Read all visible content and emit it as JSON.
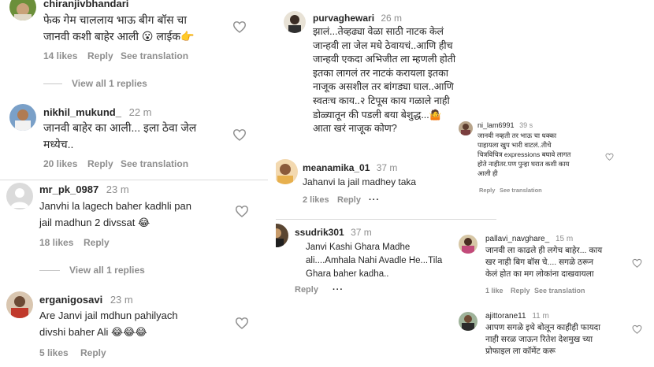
{
  "left_panel": {
    "comments": [
      {
        "username": "chiranjivbhandari",
        "time": "",
        "text": "फेक गेम चाललाय भाऊ बीग बॉस चा\nजानवी कशी बाहेर आली 😮 लाईक👉",
        "likes": "14 likes",
        "reply": "Reply",
        "translate": "See translation"
      },
      {
        "username": "nikhil_mukund_",
        "time": "22 m",
        "text": "जानवी बाहेर का आली... इला ठेवा जेल\nमध्येच..",
        "likes": "20 likes",
        "reply": "Reply",
        "translate": "See translation"
      },
      {
        "username": "mr_pk_0987",
        "time": "23 m",
        "text": "Janvhi la lagech baher kadhli pan\njail madhun 2 divssat 😂",
        "likes": "18 likes",
        "reply": "Reply",
        "translate": ""
      },
      {
        "username": "erganigosavi",
        "time": "23 m",
        "text": "Are Janvi jail mdhun pahilyach\ndivshi baher Ali 😂😂😂",
        "likes": "5 likes",
        "reply": "Reply",
        "translate": ""
      }
    ],
    "view_replies_1": "View all 1 replies",
    "view_replies_2": "View all 1 replies"
  },
  "middle_panel": {
    "comments": [
      {
        "username": "purvaghewari",
        "time": "26 m",
        "text": "झालं...तेव्हढ्या वेळा साठी नाटक केलं\nजान्हवी ला जेल मधे ठेवायचं..आणि हीच\nजान्हवी एकदा अभिजीत ला म्हणली होती\nइतका लागलं तर नाटकं करायला इतका\nनाजूक असशील तर बांगड्या घाल..आणि\nस्वतःच काय..२ टिपूस काय गळाले नाही\nडोळ्यातून की पडली बया बेशुद्ध...🤷\nआता खरं नाजूक कोण?",
        "likes": "",
        "reply": "",
        "translate": ""
      },
      {
        "username": "meanamika_01",
        "time": "37 m",
        "text": "Jahanvi la jail madhey taka",
        "likes": "2 likes",
        "reply": "Reply",
        "translate": ""
      },
      {
        "username": "ssudrik301",
        "time": "37 m",
        "text": "Janvi Kashi Ghara Madhe\nali....Amhala Nahi Avadle He...Tila\nGhara baher kadha..",
        "likes": "",
        "reply": "Reply",
        "translate": ""
      }
    ],
    "more": "···"
  },
  "popup_1": {
    "username": "ni_lam6991",
    "time": "39 s",
    "text": "जानवी नव्हती तर भाऊ चा धक्का\nपाहायला खुप भारी वाटलं..तीचे\nचित्रविचित्र expressions बघावे लागत\nहोते नाहीतर.पण पुन्हा घरात कशी काय\nआली ही",
    "reply": "Reply",
    "translate": "See translation"
  },
  "popup_2": {
    "comments": [
      {
        "username": "pallavi_navghare_",
        "time": "15 m",
        "text": "जानवी ला काढले ही लगेच बाहेर... काय\nखर नाही बिग बॉस चे.... सगळे ठरून\nकेलं होत का मग लोकांना दाखवायला",
        "likes": "1 like",
        "reply": "Reply",
        "translate": "See translation"
      },
      {
        "username": "ajittorane11",
        "time": "11 m",
        "text": "आपण सगळे इथे बोलून काहीही फायदा\nनाही सरळ जाऊन रितेश देशमुख च्या\nप्रोफाइल ला कॉमेंट करू",
        "likes": "",
        "reply": "",
        "translate": ""
      }
    ]
  },
  "icons": {
    "heart": "heart-outline-icon",
    "more": "more-dots-icon"
  },
  "colors": {
    "text": "#262626",
    "muted": "#8e8e8e",
    "divider": "#dbdbdb"
  }
}
